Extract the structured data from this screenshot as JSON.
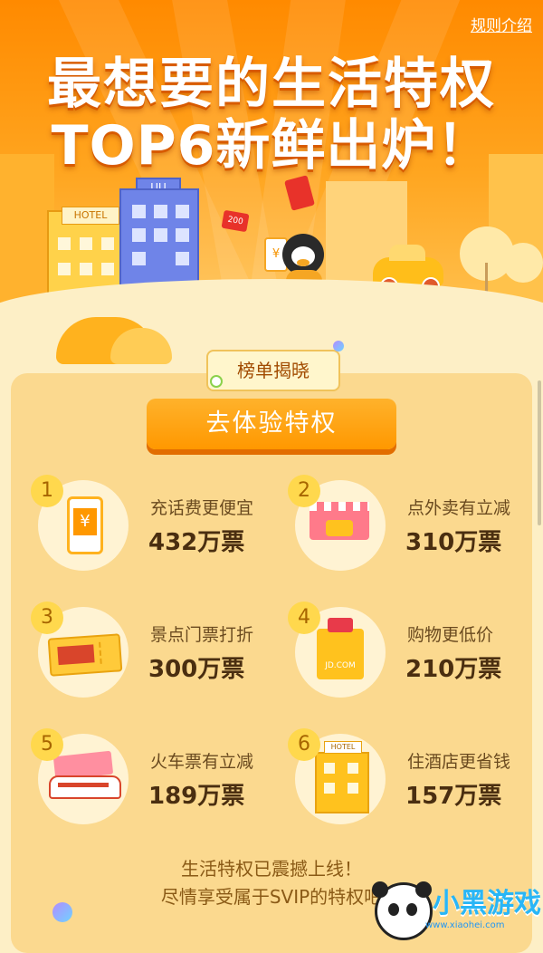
{
  "header": {
    "rules_link": "规则介绍",
    "title_line1": "最想要的生活特权",
    "title_line2": "TOP6新鲜出炉！"
  },
  "hero_illustration": {
    "hotel_sign": "HOTEL",
    "tower_sign": "UU",
    "red_packet_badge": "200",
    "phone_symbol": "¥"
  },
  "section": {
    "badge": "榜单揭晓",
    "cta_button": "去体验特权"
  },
  "ranking": [
    {
      "rank": "1",
      "label": "充话费更便宜",
      "votes": "432万票",
      "icon": "phone-recharge-icon"
    },
    {
      "rank": "2",
      "label": "点外卖有立减",
      "votes": "310万票",
      "icon": "takeout-scooter-icon"
    },
    {
      "rank": "3",
      "label": "景点门票打折",
      "votes": "300万票",
      "icon": "ticket-icon"
    },
    {
      "rank": "4",
      "label": "购物更低价",
      "votes": "210万票",
      "icon": "shopping-bag-icon",
      "bag_text": "JD.COM"
    },
    {
      "rank": "5",
      "label": "火车票有立减",
      "votes": "189万票",
      "icon": "train-icon"
    },
    {
      "rank": "6",
      "label": "住酒店更省钱",
      "votes": "157万票",
      "icon": "hotel-icon",
      "hotel_sign": "HOTEL"
    }
  ],
  "footer": {
    "line1": "生活特权已震撼上线！",
    "line2": "尽情享受属于SVIP的特权吧"
  },
  "watermark": {
    "name": "小黑游戏",
    "url": "www.xiaohei.com"
  },
  "colors": {
    "primary_orange": "#ff9800",
    "panel_yellow": "#fbd98f",
    "background": "#fdefc6",
    "text_brown": "#6a4a1f"
  }
}
